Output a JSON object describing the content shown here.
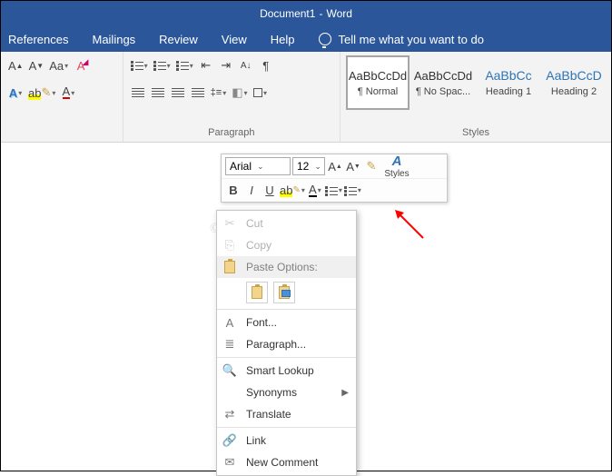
{
  "title": {
    "doc": "Document1",
    "app": "Word"
  },
  "menu": {
    "references": "References",
    "mailings": "Mailings",
    "review": "Review",
    "view": "View",
    "help": "Help",
    "tell_me": "Tell me what you want to do"
  },
  "ribbon": {
    "paragraph_label": "Paragraph",
    "styles_label": "Styles"
  },
  "styles": [
    {
      "preview": "AaBbCcDd",
      "name": "¶ Normal",
      "selected": true,
      "heading": false
    },
    {
      "preview": "AaBbCcDd",
      "name": "¶ No Spac...",
      "selected": false,
      "heading": false
    },
    {
      "preview": "AaBbCc",
      "name": "Heading 1",
      "selected": false,
      "heading": true
    },
    {
      "preview": "AaBbCcD",
      "name": "Heading 2",
      "selected": false,
      "heading": true
    }
  ],
  "mini": {
    "font": "Arial",
    "size": "12",
    "styles_label": "Styles"
  },
  "ctx": {
    "cut": "Cut",
    "copy": "Copy",
    "paste_header": "Paste Options:",
    "font": "Font...",
    "paragraph": "Paragraph...",
    "smart_lookup": "Smart Lookup",
    "synonyms": "Synonyms",
    "translate": "Translate",
    "link": "Link",
    "new_comment": "New Comment"
  },
  "watermark": "©TheGeekPage.com"
}
